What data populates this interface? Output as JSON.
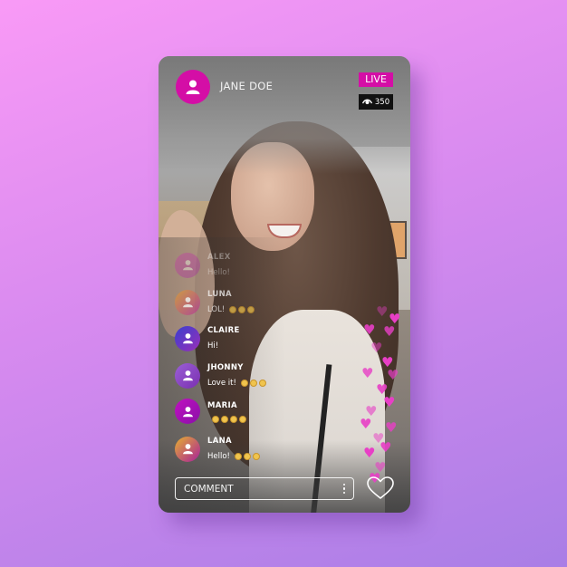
{
  "stream": {
    "host": {
      "name": "JANE DOE",
      "avatar_icon": "user-icon",
      "avatar_color": "#d40ea6"
    },
    "live_label": "LIVE",
    "live_color": "#d40ea6",
    "viewers": {
      "icon": "eye-icon",
      "count": "350"
    }
  },
  "comments": [
    {
      "user": "ALEX",
      "message": "Hello!",
      "emoji_count": 0,
      "avatar_gradient": [
        "#d42fb0",
        "#a020a0"
      ],
      "state": "faded"
    },
    {
      "user": "LUNA",
      "message": "LOL!",
      "emoji_count": 3,
      "avatar_gradient": [
        "#e0a030",
        "#b4309a"
      ],
      "state": "semi"
    },
    {
      "user": "CLAIRE",
      "message": "Hi!",
      "emoji_count": 0,
      "avatar_gradient": [
        "#3a3fcf",
        "#9a2fb8"
      ],
      "state": "normal"
    },
    {
      "user": "JHONNY",
      "message": "Love it!",
      "emoji_count": 3,
      "avatar_gradient": [
        "#9a5fd6",
        "#7a2fb0"
      ],
      "state": "normal"
    },
    {
      "user": "MARIA",
      "message": "",
      "emoji_count": 4,
      "avatar_gradient": [
        "#c010c0",
        "#8a10a8"
      ],
      "state": "normal"
    },
    {
      "user": "LANA",
      "message": "Hello!",
      "emoji_count": 3,
      "avatar_gradient": [
        "#e6b030",
        "#a8209a"
      ],
      "state": "normal"
    }
  ],
  "composer": {
    "placeholder": "COMMENT",
    "more_icon": "more-vertical-icon",
    "like_icon": "heart-icon"
  },
  "reactions": {
    "icon": "heart-icon",
    "color": "#e83fc6"
  }
}
